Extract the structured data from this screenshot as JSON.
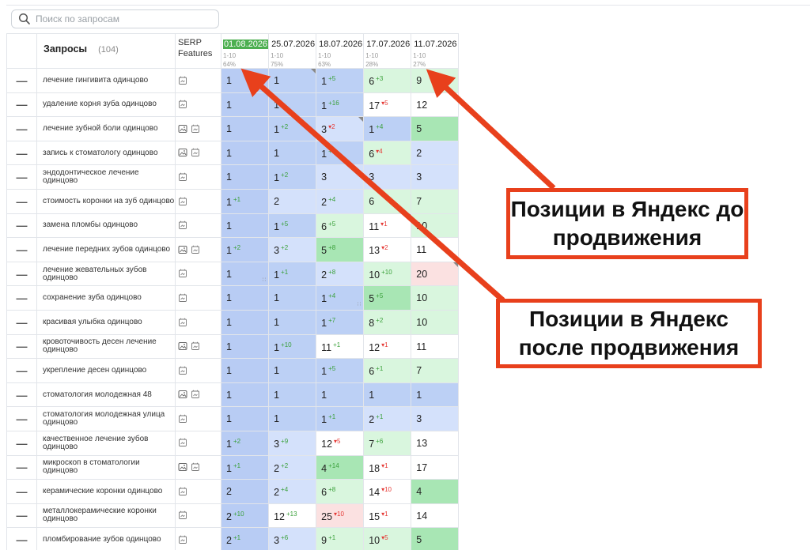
{
  "search": {
    "placeholder": "Поиск по запросам"
  },
  "header": {
    "queries_label": "Запросы",
    "queries_count": "(104)",
    "serp_label": "SERP Features",
    "dates": [
      {
        "date": "01.08.2026",
        "range": "1-10",
        "pct": "64%",
        "active": true
      },
      {
        "date": "25.07.2026",
        "range": "1-10",
        "pct": "75%",
        "active": false
      },
      {
        "date": "18.07.2026",
        "range": "1-10",
        "pct": "63%",
        "active": false
      },
      {
        "date": "17.07.2026",
        "range": "1-10",
        "pct": "28%",
        "active": false
      },
      {
        "date": "11.07.2026",
        "range": "1-10",
        "pct": "27%",
        "active": false
      }
    ]
  },
  "rows": [
    {
      "query": "лечение гингивита одинцово",
      "img": false,
      "cells": [
        [
          "1",
          "",
          ""
        ],
        [
          "1",
          "",
          ""
        ],
        [
          "1",
          "5",
          "up"
        ],
        [
          "6",
          "3",
          "up"
        ],
        [
          "9",
          "",
          ""
        ]
      ]
    },
    {
      "query": "удаление корня зуба одинцово",
      "img": false,
      "cells": [
        [
          "1",
          "",
          ""
        ],
        [
          "1",
          "",
          ""
        ],
        [
          "1",
          "16",
          "up"
        ],
        [
          "17",
          "5",
          "down"
        ],
        [
          "12",
          "",
          ""
        ]
      ]
    },
    {
      "query": "лечение зубной боли одинцово",
      "img": true,
      "cells": [
        [
          "1",
          "",
          ""
        ],
        [
          "1",
          "2",
          "up"
        ],
        [
          "3",
          "2",
          "down"
        ],
        [
          "1",
          "4",
          "up"
        ],
        [
          "5",
          "",
          ""
        ]
      ]
    },
    {
      "query": "запись к стоматологу одинцово",
      "img": true,
      "cells": [
        [
          "1",
          "",
          ""
        ],
        [
          "1",
          "",
          ""
        ],
        [
          "1",
          "5",
          "up"
        ],
        [
          "6",
          "4",
          "down"
        ],
        [
          "2",
          "",
          ""
        ]
      ]
    },
    {
      "query": "эндодонтическое лечение одинцово",
      "img": false,
      "cells": [
        [
          "1",
          "",
          ""
        ],
        [
          "1",
          "2",
          "up"
        ],
        [
          "3",
          "",
          ""
        ],
        [
          "3",
          "",
          ""
        ],
        [
          "3",
          "",
          ""
        ]
      ]
    },
    {
      "query": "стоимость коронки на зуб одинцово",
      "img": false,
      "cells": [
        [
          "1",
          "1",
          "up"
        ],
        [
          "2",
          "",
          ""
        ],
        [
          "2",
          "4",
          "up"
        ],
        [
          "6",
          "",
          ""
        ],
        [
          "7",
          "",
          ""
        ]
      ]
    },
    {
      "query": "замена пломбы одинцово",
      "img": false,
      "cells": [
        [
          "1",
          "",
          ""
        ],
        [
          "1",
          "5",
          "up"
        ],
        [
          "6",
          "5",
          "up"
        ],
        [
          "11",
          "1",
          "down"
        ],
        [
          "10",
          "",
          ""
        ]
      ]
    },
    {
      "query": "лечение передних зубов одинцово",
      "img": true,
      "cells": [
        [
          "1",
          "2",
          "up"
        ],
        [
          "3",
          "2",
          "up"
        ],
        [
          "5",
          "8",
          "up"
        ],
        [
          "13",
          "2",
          "down"
        ],
        [
          "11",
          "",
          ""
        ]
      ]
    },
    {
      "query": "лечение жевательных зубов одинцово",
      "img": false,
      "cells": [
        [
          "1",
          "",
          ""
        ],
        [
          "1",
          "1",
          "up"
        ],
        [
          "2",
          "8",
          "up"
        ],
        [
          "10",
          "10",
          "up"
        ],
        [
          "20",
          "",
          ""
        ]
      ]
    },
    {
      "query": "сохранение зуба одинцово",
      "img": false,
      "cells": [
        [
          "1",
          "",
          ""
        ],
        [
          "1",
          "",
          ""
        ],
        [
          "1",
          "4",
          "up"
        ],
        [
          "5",
          "5",
          "up"
        ],
        [
          "10",
          "",
          ""
        ]
      ]
    },
    {
      "query": "красивая улыбка одинцово",
      "img": false,
      "cells": [
        [
          "1",
          "",
          ""
        ],
        [
          "1",
          "",
          ""
        ],
        [
          "1",
          "7",
          "up"
        ],
        [
          "8",
          "2",
          "up"
        ],
        [
          "10",
          "",
          ""
        ]
      ]
    },
    {
      "query": "кровоточивость десен лечение одинцово",
      "img": true,
      "cells": [
        [
          "1",
          "",
          ""
        ],
        [
          "1",
          "10",
          "up"
        ],
        [
          "11",
          "1",
          "up"
        ],
        [
          "12",
          "1",
          "down"
        ],
        [
          "11",
          "",
          ""
        ]
      ]
    },
    {
      "query": "укрепление десен одинцово",
      "img": false,
      "cells": [
        [
          "1",
          "",
          ""
        ],
        [
          "1",
          "",
          ""
        ],
        [
          "1",
          "5",
          "up"
        ],
        [
          "6",
          "1",
          "up"
        ],
        [
          "7",
          "",
          ""
        ]
      ]
    },
    {
      "query": "стоматология молодежная 48",
      "img": true,
      "cells": [
        [
          "1",
          "",
          ""
        ],
        [
          "1",
          "",
          ""
        ],
        [
          "1",
          "",
          ""
        ],
        [
          "1",
          "",
          ""
        ],
        [
          "1",
          "",
          ""
        ]
      ]
    },
    {
      "query": "стоматология молодежная улица одинцово",
      "img": false,
      "cells": [
        [
          "1",
          "",
          ""
        ],
        [
          "1",
          "",
          ""
        ],
        [
          "1",
          "1",
          "up"
        ],
        [
          "2",
          "1",
          "up"
        ],
        [
          "3",
          "",
          ""
        ]
      ]
    },
    {
      "query": "качественное лечение зубов одинцово",
      "img": false,
      "cells": [
        [
          "1",
          "2",
          "up"
        ],
        [
          "3",
          "9",
          "up"
        ],
        [
          "12",
          "5",
          "down"
        ],
        [
          "7",
          "6",
          "up"
        ],
        [
          "13",
          "",
          ""
        ]
      ]
    },
    {
      "query": "микроскоп в стоматологии одинцово",
      "img": true,
      "cells": [
        [
          "1",
          "1",
          "up"
        ],
        [
          "2",
          "2",
          "up"
        ],
        [
          "4",
          "14",
          "up"
        ],
        [
          "18",
          "1",
          "down"
        ],
        [
          "17",
          "",
          ""
        ]
      ]
    },
    {
      "query": "керамические коронки одинцово",
      "img": false,
      "cells": [
        [
          "2",
          "",
          ""
        ],
        [
          "2",
          "4",
          "up"
        ],
        [
          "6",
          "8",
          "up"
        ],
        [
          "14",
          "10",
          "down"
        ],
        [
          "4",
          "",
          ""
        ]
      ]
    },
    {
      "query": "металлокерамические коронки одинцово",
      "img": false,
      "cells": [
        [
          "2",
          "10",
          "up"
        ],
        [
          "12",
          "13",
          "up"
        ],
        [
          "25",
          "10",
          "down"
        ],
        [
          "15",
          "1",
          "down"
        ],
        [
          "14",
          "",
          ""
        ]
      ]
    },
    {
      "query": "пломбирование зубов одинцово",
      "img": false,
      "cells": [
        [
          "2",
          "1",
          "up"
        ],
        [
          "3",
          "6",
          "up"
        ],
        [
          "9",
          "1",
          "up"
        ],
        [
          "10",
          "5",
          "down"
        ],
        [
          "5",
          "",
          ""
        ]
      ]
    }
  ],
  "callouts": {
    "before": "Позиции в Яндекс до продвижения",
    "after": "Позиции в Яндекс после продвижения"
  },
  "colors": {
    "accent_green": "#4caf50",
    "arrow_red": "#e8401c",
    "up": "#3aa03a",
    "down": "#e53935"
  }
}
